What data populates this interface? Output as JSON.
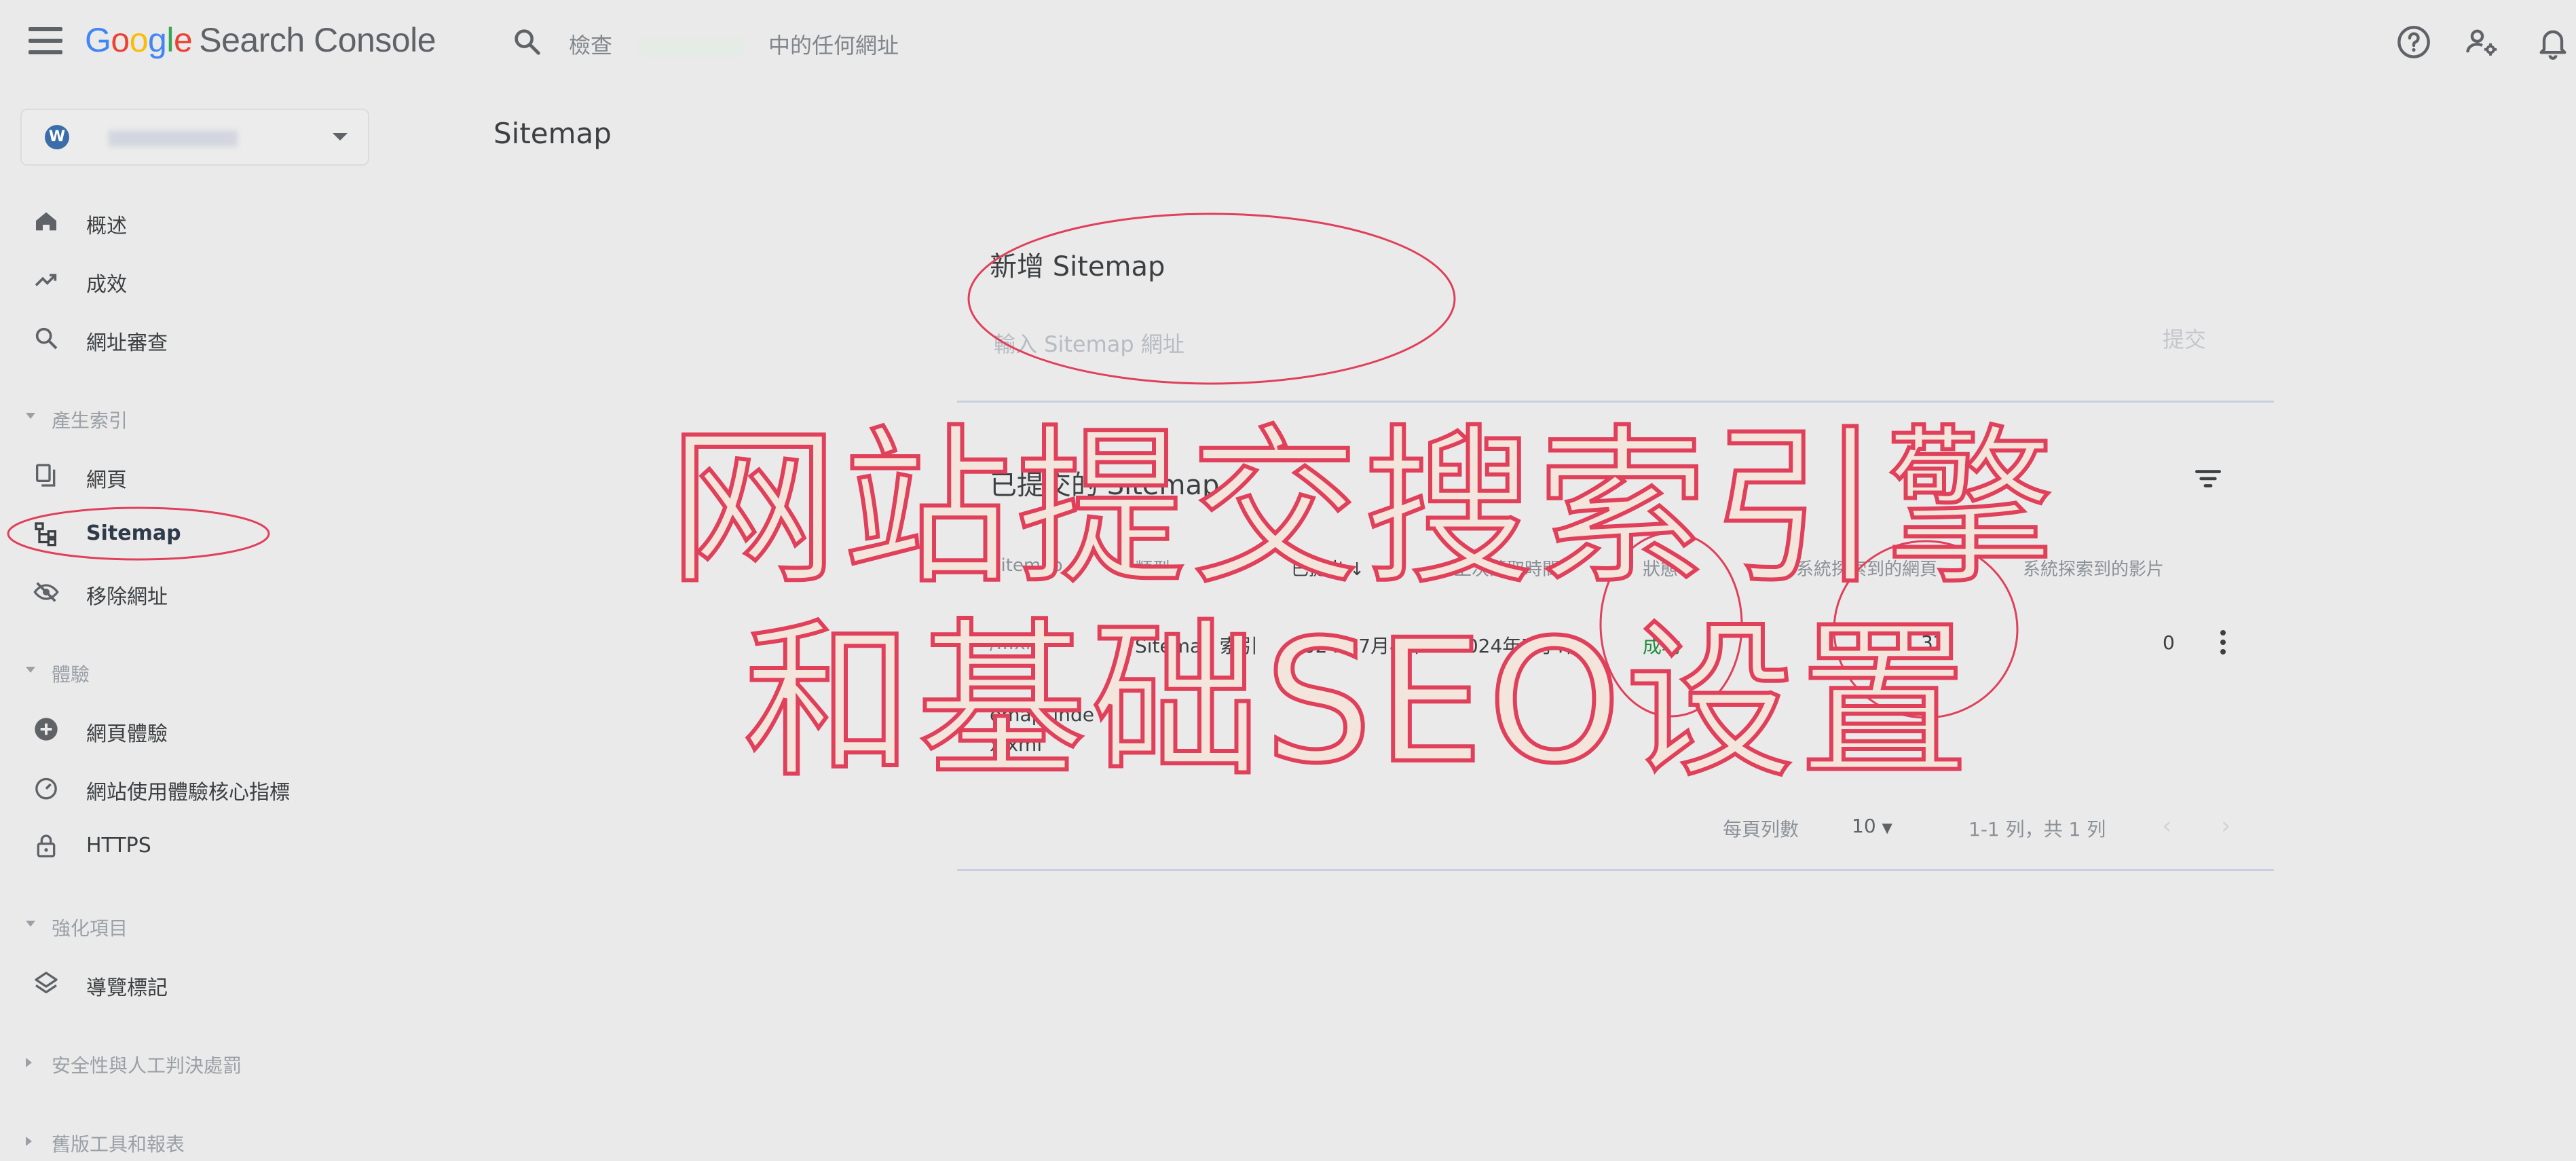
{
  "header": {
    "logo_letters": [
      "G",
      "o",
      "o",
      "g",
      "l",
      "e"
    ],
    "logo_colors": [
      "#4285f4",
      "#ea4335",
      "#fbbc05",
      "#4285f4",
      "#34a853",
      "#ea4335"
    ],
    "product_name": "Search Console",
    "search_text_before": "檢查",
    "search_text_after": "中的任何網址",
    "icons": [
      "help-icon",
      "account-settings-icon",
      "notifications-icon"
    ]
  },
  "sidebar": {
    "property_icon_text": "W",
    "items_main": [
      {
        "label": "概述",
        "icon": "home-icon"
      },
      {
        "label": "成效",
        "icon": "trending-icon"
      },
      {
        "label": "網址審查",
        "icon": "search-icon"
      }
    ],
    "section_indexing": "產生索引",
    "items_indexing": [
      {
        "label": "網頁",
        "icon": "pages-icon"
      },
      {
        "label": "Sitemap",
        "icon": "sitemap-icon"
      },
      {
        "label": "移除網址",
        "icon": "removals-icon"
      }
    ],
    "section_experience": "體驗",
    "items_experience": [
      {
        "label": "網頁體驗",
        "icon": "page-experience-icon"
      },
      {
        "label": "網站使用體驗核心指標",
        "icon": "speed-icon"
      },
      {
        "label": "HTTPS",
        "icon": "lock-icon"
      }
    ],
    "section_enhancements": "強化項目",
    "items_enhancements": [
      {
        "label": "導覽標記",
        "icon": "breadcrumb-layers-icon"
      }
    ],
    "section_security": "安全性與人工判決處罰",
    "section_legacy": "舊版工具和報表"
  },
  "main": {
    "page_title": "Sitemap",
    "add_sitemap": {
      "title": "新增 Sitemap",
      "input_placeholder": "輸入 Sitemap 網址",
      "submit_label": "提交"
    },
    "submitted": {
      "title": "已提交的 Sitemap",
      "columns": [
        "Sitemap",
        "類型",
        "已提出",
        "上次讀取時間",
        "狀態",
        "系統探索到的網頁",
        "系統探索到的影片"
      ],
      "rows": [
        {
          "sitemap_line1": "/...xml",
          "sitemap_line2": "emap_inde",
          "sitemap_line3": "x.xml",
          "type": "Sitemap 索引",
          "submitted": "2024年7月4日",
          "last_read": "2024年7月4日",
          "status": "成功",
          "pages": "32",
          "videos": "0"
        }
      ],
      "rows_per_page_label": "每頁列數",
      "rows_per_page_value": "10",
      "range_text": "1-1 列，共 1 列"
    }
  },
  "overlay": {
    "line1": "网站提交搜索引擎",
    "line2": "和基础SEO设置",
    "color": "#e0405a"
  }
}
